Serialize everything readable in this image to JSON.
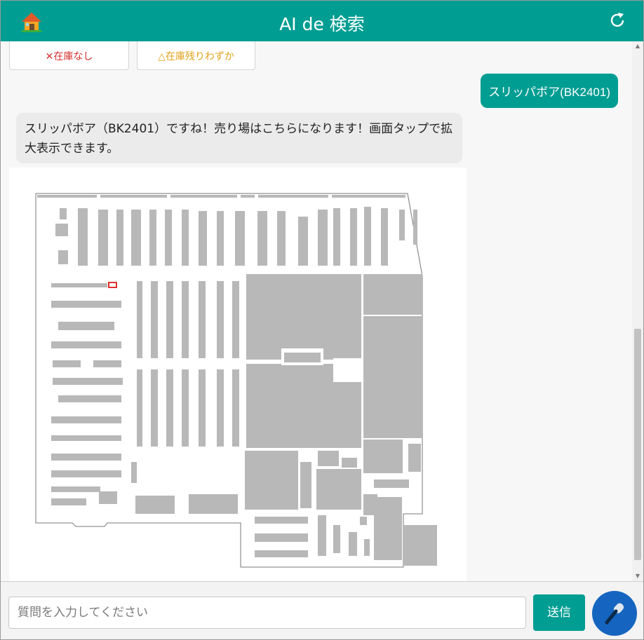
{
  "header": {
    "title": "AI de 検索",
    "home_icon": "home-icon",
    "refresh_icon": "refresh-icon"
  },
  "stock_buttons": {
    "none_label": "✕在庫なし",
    "few_label": "△在庫残りわずか"
  },
  "messages": {
    "user": "スリッパボア(BK2401)",
    "bot": "スリッパボア（BK2401）ですね！売り場はこちらになります！画面タップで拡大表示できます。"
  },
  "map": {
    "image_name": "store-floor-map"
  },
  "input": {
    "placeholder": "質問を入力してください",
    "value": ""
  },
  "send_button": {
    "label": "送信"
  },
  "mic_button": {
    "icon": "microphone-icon"
  },
  "colors": {
    "accent": "#009d92",
    "mic": "#1565c0",
    "stock_none": "#d43030",
    "stock_few": "#e2a21f",
    "highlight": "#e03030"
  }
}
